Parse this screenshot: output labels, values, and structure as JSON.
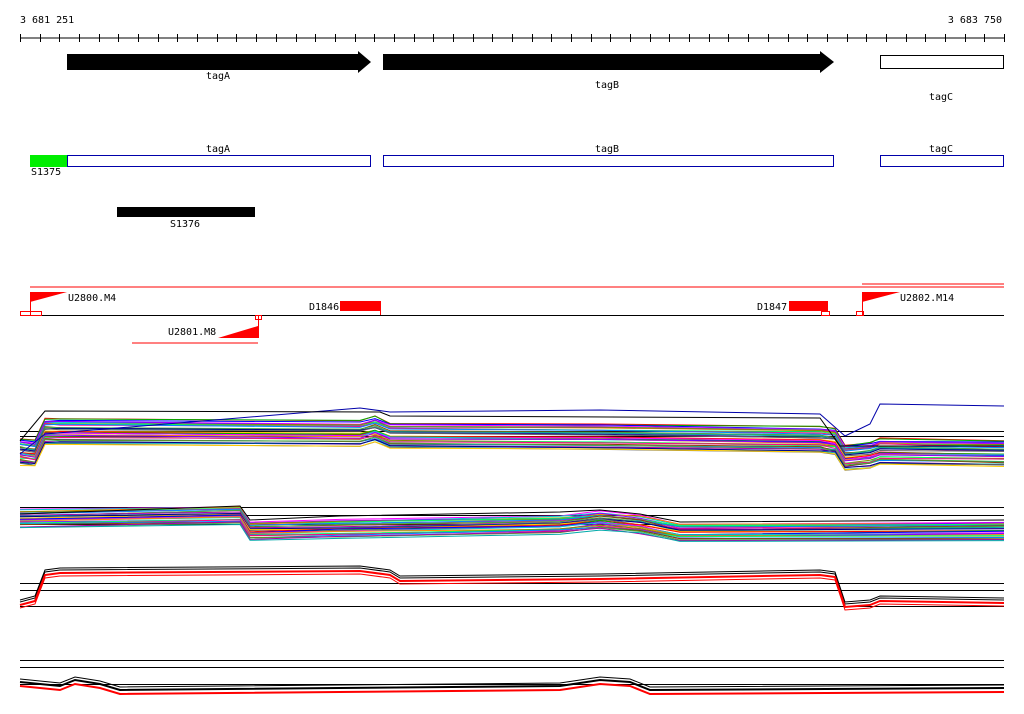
{
  "coords": {
    "start": "3 681 251",
    "end": "3 683 750"
  },
  "genes": [
    {
      "name": "tagA",
      "style": "filled-arrow"
    },
    {
      "name": "tagB",
      "style": "filled-arrow"
    },
    {
      "name": "tagC",
      "style": "outline-box"
    }
  ],
  "annotation_track": {
    "boxes": [
      "tagA",
      "tagB",
      "tagC"
    ],
    "segments": [
      {
        "label": "S1375",
        "color": "#00ee00"
      },
      {
        "label": "S1376",
        "color": "#000000"
      }
    ]
  },
  "features": [
    {
      "label": "U2800.M4",
      "color": "#ff0000"
    },
    {
      "label": "U2801.M8",
      "color": "#ff0000"
    },
    {
      "label": "D1846",
      "color": "#ff0000"
    },
    {
      "label": "D1847",
      "color": "#ff0000"
    },
    {
      "label": "U2802.M14",
      "color": "#ff0000"
    }
  ],
  "expression_panels": [
    {
      "name": "panel-1",
      "style": "multicolor"
    },
    {
      "name": "panel-2",
      "style": "multicolor"
    },
    {
      "name": "panel-3",
      "style": "black-red"
    },
    {
      "name": "panel-4",
      "style": "black-red"
    }
  ],
  "colors": {
    "gene_outline": "#0000aa",
    "feature": "#ff0000",
    "start_segment": "#00ee00"
  }
}
